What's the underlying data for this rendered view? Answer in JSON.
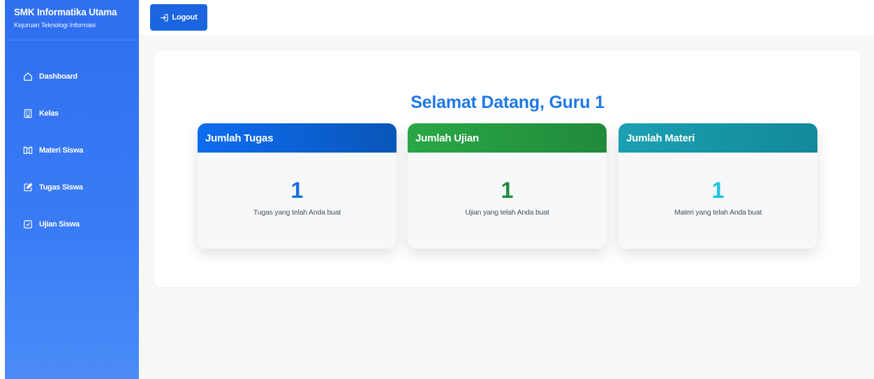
{
  "sidebar": {
    "title": "SMK Informatika Utama",
    "subtitle": "Kejuruan Teknologi Informasi",
    "items": [
      {
        "label": "Dashboard",
        "icon": "home-icon"
      },
      {
        "label": "Kelas",
        "icon": "building-icon"
      },
      {
        "label": "Materi Siswa",
        "icon": "book-icon"
      },
      {
        "label": "Tugas Siswa",
        "icon": "edit-icon"
      },
      {
        "label": "Ujian Siswa",
        "icon": "check-square-icon"
      }
    ]
  },
  "topbar": {
    "logout_label": "Logout",
    "logout_icon": "logout-icon",
    "button_color": "#1b66e0"
  },
  "main": {
    "welcome": "Selamat Datang, Guru 1",
    "cards": [
      {
        "title": "Jumlah Tugas",
        "value": "1",
        "description": "Tugas yang telah Anda buat",
        "color": "#0d6cf0"
      },
      {
        "title": "Jumlah Ujian",
        "value": "1",
        "description": "Ujian yang telah Anda buat",
        "color": "#29a745"
      },
      {
        "title": "Jumlah Materi",
        "value": "1",
        "description": "Materi yang telah Anda buat",
        "color": "#1aa0b2"
      }
    ]
  },
  "colors": {
    "sidebar": "#2f6ff0",
    "accent": "#1f78e6",
    "background": "#f7f8fa"
  }
}
